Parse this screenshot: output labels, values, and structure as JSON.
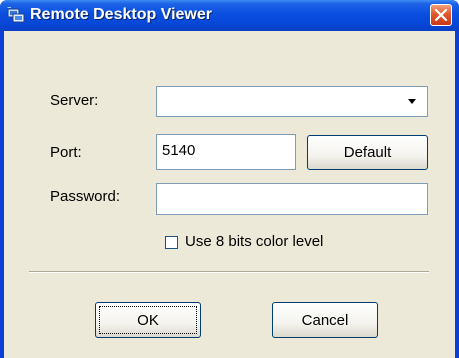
{
  "window": {
    "title": "Remote Desktop Viewer",
    "title_icon": "remote-desktop-app-icon",
    "close_icon": "close-icon"
  },
  "form": {
    "server_label": "Server:",
    "server_value": "",
    "server_dropdown_icon": "chevron-down-icon",
    "port_label": "Port:",
    "port_value": "5140",
    "default_button": "Default",
    "password_label": "Password:",
    "password_value": "",
    "color_checkbox_label": "Use 8 bits color level",
    "color_checkbox_checked": false
  },
  "buttons": {
    "ok": "OK",
    "cancel": "Cancel"
  }
}
